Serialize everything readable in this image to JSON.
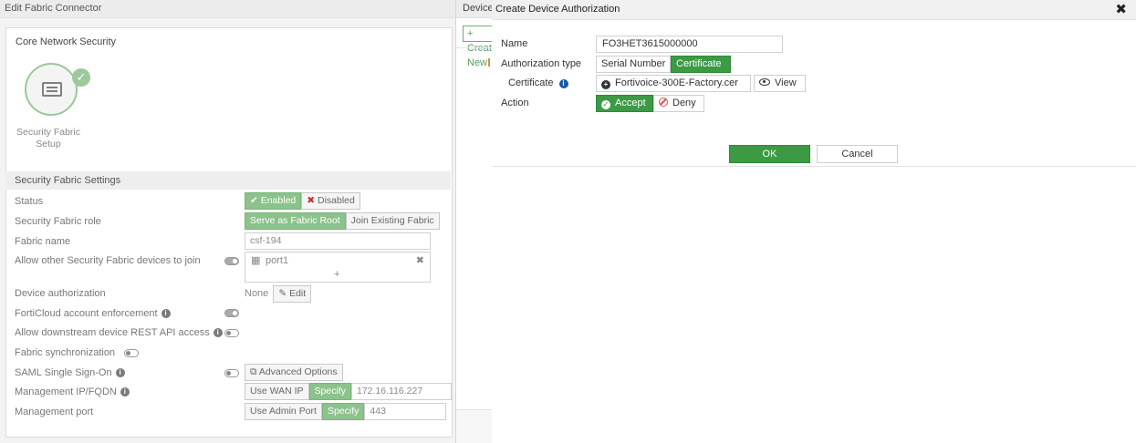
{
  "background": {
    "title": "Edit Fabric Connector",
    "card_title": "Core Network Security",
    "icon_label": "Security Fabric Setup",
    "section_title": "Security Fabric Settings",
    "rows": {
      "status": {
        "label": "Status",
        "enabled": "Enabled",
        "disabled": "Disabled"
      },
      "role": {
        "label": "Security Fabric role",
        "root": "Serve as Fabric Root",
        "join": "Join Existing Fabric"
      },
      "fabric_name": {
        "label": "Fabric name",
        "value": "csf-194"
      },
      "allow_join": {
        "label": "Allow other Security Fabric devices to join",
        "interface": "port1",
        "add": "+",
        "remove": "✖"
      },
      "device_auth": {
        "label": "Device authorization",
        "value": "None",
        "edit": "Edit"
      },
      "forticloud": {
        "label": "FortiCloud account enforcement"
      },
      "rest_api": {
        "label": "Allow downstream device REST API access"
      },
      "fabric_sync": {
        "label": "Fabric synchronization"
      },
      "saml": {
        "label": "SAML Single Sign-On",
        "advanced": "Advanced Options"
      },
      "mgmt_ip": {
        "label": "Management IP/FQDN",
        "opt1": "Use WAN IP",
        "opt2": "Specify",
        "value": "172.16.116.227"
      },
      "mgmt_port": {
        "label": "Management port",
        "opt1": "Use Admin Port",
        "opt2": "Specify",
        "value": "443"
      }
    }
  },
  "middle": {
    "title": "Device",
    "create_button": "+ Create New"
  },
  "dialog": {
    "title": "Create Device Authorization",
    "close": "✖",
    "name_label": "Name",
    "name_value": "FO3HET3615000000",
    "auth_type_label": "Authorization type",
    "auth_type_serial": "Serial Number",
    "auth_type_certificate": "Certificate",
    "certificate_label": "Certificate",
    "certificate_value": "Fortivoice-300E-Factory.cer",
    "view_button": "View",
    "action_label": "Action",
    "accept_button": "Accept",
    "deny_button": "Deny",
    "ok_button": "OK",
    "cancel_button": "Cancel"
  },
  "colors": {
    "accent_green": "#3c9a45",
    "faded_green": "#8cc28b",
    "info_blue": "#1a5aa3",
    "deny_red": "#d9534f"
  }
}
